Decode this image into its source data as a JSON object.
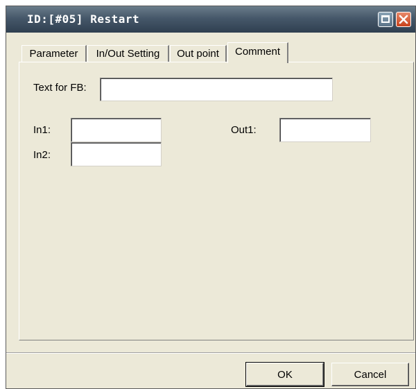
{
  "window": {
    "title": "ID:[#05] Restart"
  },
  "titlebar_buttons": {
    "maximize_icon": "maximize-icon",
    "close_icon": "close-icon"
  },
  "tabs": [
    {
      "label": "Parameter",
      "active": false
    },
    {
      "label": "In/Out Setting",
      "active": false
    },
    {
      "label": "Out point",
      "active": false
    },
    {
      "label": "Comment",
      "active": true
    }
  ],
  "form": {
    "text_for_fb_label": "Text for FB:",
    "text_for_fb_value": "",
    "in1_label": "In1:",
    "in1_value": "",
    "in2_label": "In2:",
    "in2_value": "",
    "out1_label": "Out1:",
    "out1_value": ""
  },
  "buttons": {
    "ok_label": "OK",
    "cancel_label": "Cancel"
  },
  "colors": {
    "dialog_background": "#ece9d8",
    "titlebar": "#46586a",
    "close_button": "#c9411a"
  }
}
